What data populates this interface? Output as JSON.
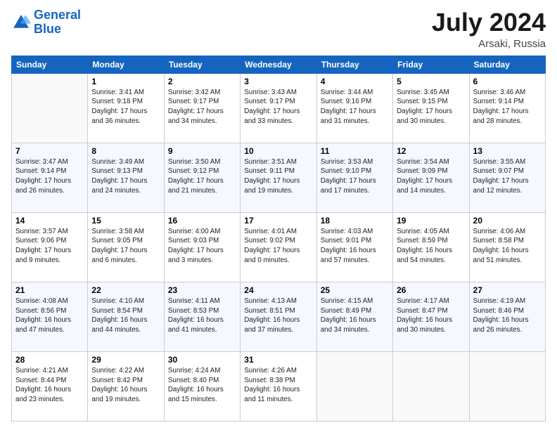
{
  "header": {
    "logo_line1": "General",
    "logo_line2": "Blue",
    "month": "July 2024",
    "location": "Arsaki, Russia"
  },
  "weekdays": [
    "Sunday",
    "Monday",
    "Tuesday",
    "Wednesday",
    "Thursday",
    "Friday",
    "Saturday"
  ],
  "weeks": [
    [
      {
        "day": "",
        "info": ""
      },
      {
        "day": "1",
        "info": "Sunrise: 3:41 AM\nSunset: 9:18 PM\nDaylight: 17 hours\nand 36 minutes."
      },
      {
        "day": "2",
        "info": "Sunrise: 3:42 AM\nSunset: 9:17 PM\nDaylight: 17 hours\nand 34 minutes."
      },
      {
        "day": "3",
        "info": "Sunrise: 3:43 AM\nSunset: 9:17 PM\nDaylight: 17 hours\nand 33 minutes."
      },
      {
        "day": "4",
        "info": "Sunrise: 3:44 AM\nSunset: 9:16 PM\nDaylight: 17 hours\nand 31 minutes."
      },
      {
        "day": "5",
        "info": "Sunrise: 3:45 AM\nSunset: 9:15 PM\nDaylight: 17 hours\nand 30 minutes."
      },
      {
        "day": "6",
        "info": "Sunrise: 3:46 AM\nSunset: 9:14 PM\nDaylight: 17 hours\nand 28 minutes."
      }
    ],
    [
      {
        "day": "7",
        "info": "Sunrise: 3:47 AM\nSunset: 9:14 PM\nDaylight: 17 hours\nand 26 minutes."
      },
      {
        "day": "8",
        "info": "Sunrise: 3:49 AM\nSunset: 9:13 PM\nDaylight: 17 hours\nand 24 minutes."
      },
      {
        "day": "9",
        "info": "Sunrise: 3:50 AM\nSunset: 9:12 PM\nDaylight: 17 hours\nand 21 minutes."
      },
      {
        "day": "10",
        "info": "Sunrise: 3:51 AM\nSunset: 9:11 PM\nDaylight: 17 hours\nand 19 minutes."
      },
      {
        "day": "11",
        "info": "Sunrise: 3:53 AM\nSunset: 9:10 PM\nDaylight: 17 hours\nand 17 minutes."
      },
      {
        "day": "12",
        "info": "Sunrise: 3:54 AM\nSunset: 9:09 PM\nDaylight: 17 hours\nand 14 minutes."
      },
      {
        "day": "13",
        "info": "Sunrise: 3:55 AM\nSunset: 9:07 PM\nDaylight: 17 hours\nand 12 minutes."
      }
    ],
    [
      {
        "day": "14",
        "info": "Sunrise: 3:57 AM\nSunset: 9:06 PM\nDaylight: 17 hours\nand 9 minutes."
      },
      {
        "day": "15",
        "info": "Sunrise: 3:58 AM\nSunset: 9:05 PM\nDaylight: 17 hours\nand 6 minutes."
      },
      {
        "day": "16",
        "info": "Sunrise: 4:00 AM\nSunset: 9:03 PM\nDaylight: 17 hours\nand 3 minutes."
      },
      {
        "day": "17",
        "info": "Sunrise: 4:01 AM\nSunset: 9:02 PM\nDaylight: 17 hours\nand 0 minutes."
      },
      {
        "day": "18",
        "info": "Sunrise: 4:03 AM\nSunset: 9:01 PM\nDaylight: 16 hours\nand 57 minutes."
      },
      {
        "day": "19",
        "info": "Sunrise: 4:05 AM\nSunset: 8:59 PM\nDaylight: 16 hours\nand 54 minutes."
      },
      {
        "day": "20",
        "info": "Sunrise: 4:06 AM\nSunset: 8:58 PM\nDaylight: 16 hours\nand 51 minutes."
      }
    ],
    [
      {
        "day": "21",
        "info": "Sunrise: 4:08 AM\nSunset: 8:56 PM\nDaylight: 16 hours\nand 47 minutes."
      },
      {
        "day": "22",
        "info": "Sunrise: 4:10 AM\nSunset: 8:54 PM\nDaylight: 16 hours\nand 44 minutes."
      },
      {
        "day": "23",
        "info": "Sunrise: 4:11 AM\nSunset: 8:53 PM\nDaylight: 16 hours\nand 41 minutes."
      },
      {
        "day": "24",
        "info": "Sunrise: 4:13 AM\nSunset: 8:51 PM\nDaylight: 16 hours\nand 37 minutes."
      },
      {
        "day": "25",
        "info": "Sunrise: 4:15 AM\nSunset: 8:49 PM\nDaylight: 16 hours\nand 34 minutes."
      },
      {
        "day": "26",
        "info": "Sunrise: 4:17 AM\nSunset: 8:47 PM\nDaylight: 16 hours\nand 30 minutes."
      },
      {
        "day": "27",
        "info": "Sunrise: 4:19 AM\nSunset: 8:46 PM\nDaylight: 16 hours\nand 26 minutes."
      }
    ],
    [
      {
        "day": "28",
        "info": "Sunrise: 4:21 AM\nSunset: 8:44 PM\nDaylight: 16 hours\nand 23 minutes."
      },
      {
        "day": "29",
        "info": "Sunrise: 4:22 AM\nSunset: 8:42 PM\nDaylight: 16 hours\nand 19 minutes."
      },
      {
        "day": "30",
        "info": "Sunrise: 4:24 AM\nSunset: 8:40 PM\nDaylight: 16 hours\nand 15 minutes."
      },
      {
        "day": "31",
        "info": "Sunrise: 4:26 AM\nSunset: 8:38 PM\nDaylight: 16 hours\nand 11 minutes."
      },
      {
        "day": "",
        "info": ""
      },
      {
        "day": "",
        "info": ""
      },
      {
        "day": "",
        "info": ""
      }
    ]
  ]
}
